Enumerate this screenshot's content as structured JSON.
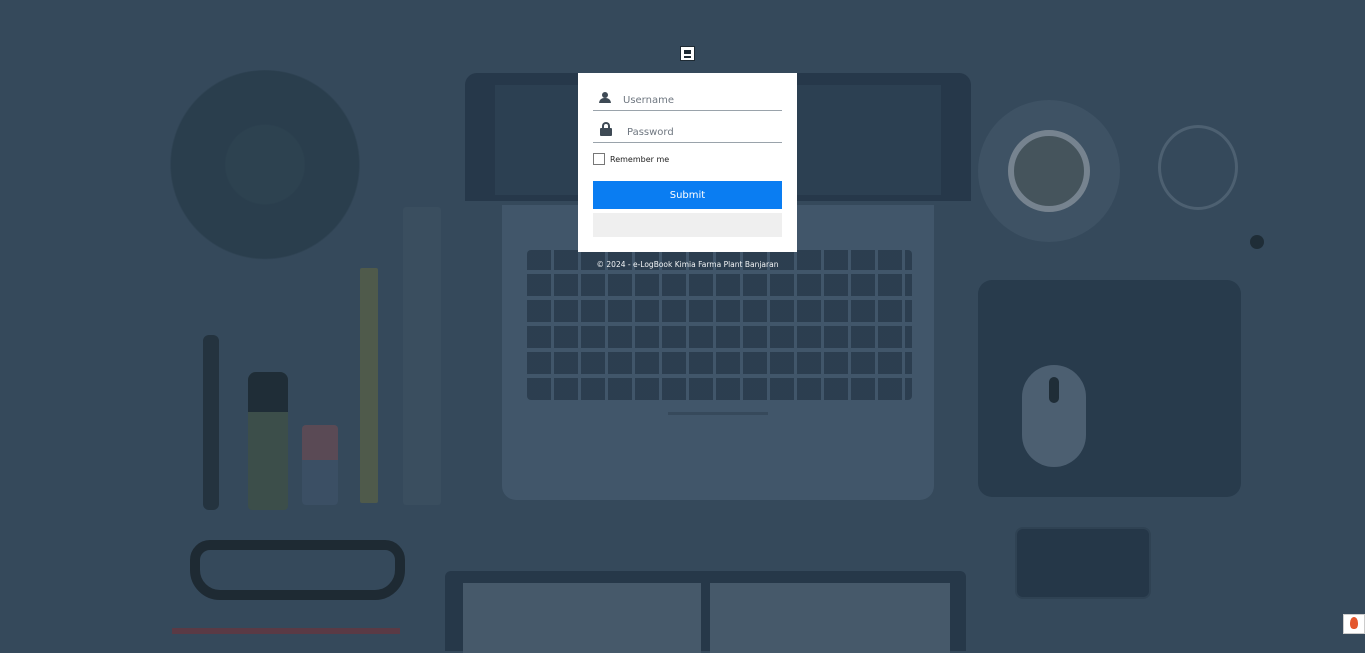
{
  "login": {
    "username_placeholder": "Username",
    "password_placeholder": "Password",
    "remember_label": "Remember me",
    "submit_label": "Submit"
  },
  "footer": {
    "copyright": "© 2024 - e-LogBook Kimia Farma Plant Banjaran"
  },
  "icons": {
    "top": "document-icon",
    "username": "user-icon",
    "password": "lock-icon",
    "corner": "flame-icon"
  },
  "colors": {
    "background": "#35495b",
    "submit_button": "#0a7df2",
    "card": "#ffffff"
  }
}
